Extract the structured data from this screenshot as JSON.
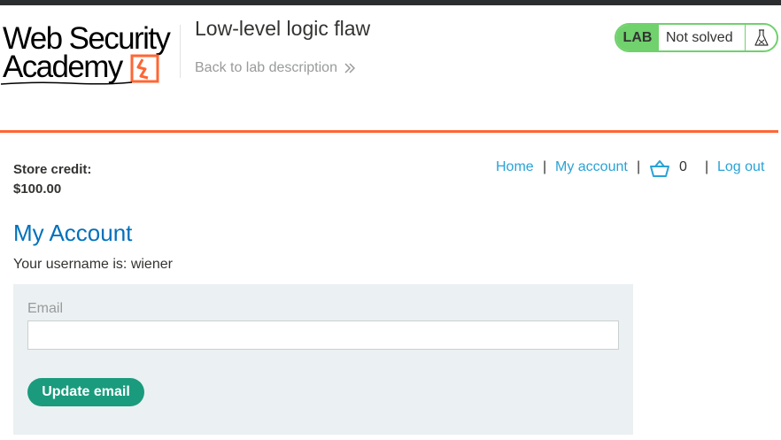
{
  "logo": {
    "line1": "Web Security",
    "line2": "Academy"
  },
  "header": {
    "lab_title": "Low-level logic flaw",
    "back_link": "Back to lab description"
  },
  "lab_status": {
    "badge": "LAB",
    "status": "Not solved",
    "icon": "flask-icon"
  },
  "store_credit": {
    "label": "Store credit:",
    "value": "$100.00"
  },
  "nav": {
    "home": "Home",
    "separator": "|",
    "my_account": "My account",
    "cart_icon": "cart-icon",
    "cart_count": "0",
    "log_out": "Log out"
  },
  "main": {
    "heading": "My Account",
    "username_text": "Your username is: wiener"
  },
  "email_form": {
    "label": "Email",
    "value": "",
    "button": "Update email"
  },
  "colors": {
    "accent_orange": "#ff6633",
    "link_blue": "#29a3d6",
    "heading_blue": "#0071bc",
    "lab_green": "#70d16d",
    "button_green": "#1a9b7d"
  }
}
